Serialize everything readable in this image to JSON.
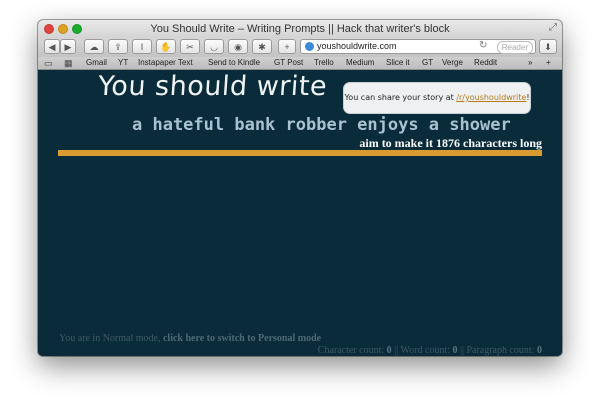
{
  "window": {
    "title": "You Should Write – Writing Prompts || Hack that writer's block"
  },
  "toolbar": {
    "back_icon": "◀",
    "forward_icon": "▶",
    "url": "youshouldwrite.com",
    "reader_label": "Reader"
  },
  "bookmarks": [
    "Gmail",
    "YT",
    "Instapaper Text",
    "Send to Kindle",
    "GT Post",
    "Trello",
    "Medium",
    "Slice it",
    "GT",
    "Verge",
    "Reddit"
  ],
  "page": {
    "site_title": "You should write",
    "share_text": "You can share your story at ",
    "share_link": "/r/youshouldwrite",
    "share_end": "!",
    "prompt": "a hateful bank robber enjoys a shower",
    "aim_text": "aim to make it 1876 characters long",
    "mode_text": "You are in Normal mode, ",
    "mode_link": "click here to switch to Personal mode",
    "char_label": "Character count: ",
    "char_count": "0",
    "word_label": " || Word count: ",
    "word_count": "0",
    "para_label": " || Paragraph count: ",
    "para_count": "0"
  },
  "colors": {
    "background": "#0a2b39",
    "accent_bar": "#d99a2f",
    "prompt_text": "#a9c1d1"
  }
}
